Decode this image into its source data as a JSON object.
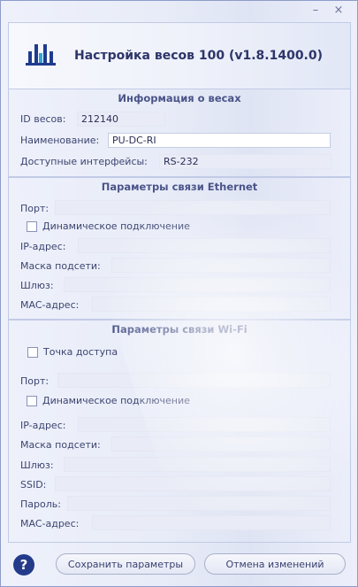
{
  "window": {
    "minimize_glyph": "–",
    "close_glyph": "×",
    "title": "Настройка весов 100 (v1.8.1400.0)",
    "logo_icon": "scales-logo-icon"
  },
  "info": {
    "title": "Информация о весах",
    "id_label": "ID весов:",
    "id_value": "212140",
    "name_label": "Наименование:",
    "name_value": "PU-DC-RI",
    "interfaces_label": "Доступные интерфейсы:",
    "interfaces_value": "RS-232"
  },
  "ethernet": {
    "title": "Параметры связи Ethernet",
    "port_label": "Порт:",
    "port_value": "",
    "dynamic_label": "Динамическое подключение",
    "dynamic_checked": false,
    "ip_label": "IP-адрес:",
    "ip_value": "",
    "mask_label": "Маска подсети:",
    "mask_value": "",
    "gateway_label": "Шлюз:",
    "gateway_value": "",
    "mac_label": "MAC-адрес:",
    "mac_value": ""
  },
  "wifi": {
    "title": "Параметры связи Wi-Fi",
    "ap_label": "Точка доступа",
    "ap_checked": false,
    "port_label": "Порт:",
    "port_value": "",
    "dynamic_label": "Динамическое подключение",
    "dynamic_checked": false,
    "ip_label": "IP-адрес:",
    "ip_value": "",
    "mask_label": "Маска подсети:",
    "mask_value": "",
    "gateway_label": "Шлюз:",
    "gateway_value": "",
    "ssid_label": "SSID:",
    "ssid_value": "",
    "password_label": "Пароль:",
    "password_value": "",
    "mac_label": "MAC-адрес:",
    "mac_value": ""
  },
  "footer": {
    "help_glyph": "?",
    "save_label": "Сохранить параметры",
    "cancel_label": "Отмена изменений"
  },
  "colors": {
    "accent": "#1f3b8f",
    "title_text": "#2d3569",
    "section_border": "#c2cbe6"
  }
}
